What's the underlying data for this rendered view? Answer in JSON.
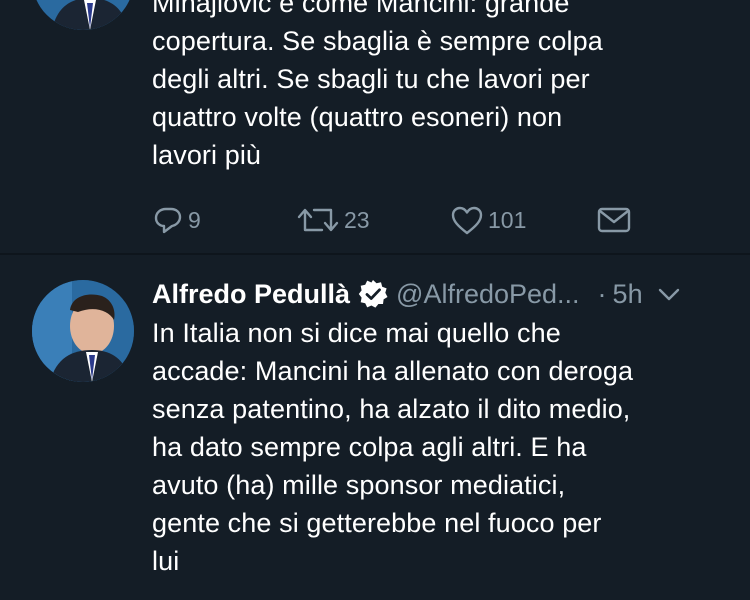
{
  "tweet_top": {
    "text": "Mihajlovic è come Mancini: grande\ncopertura. Se sbaglia è sempre colpa\ndegli altri. Se sbagli tu che lavori per\nquattro volte (quattro esoneri) non\nlavori più",
    "replies": "9",
    "retweets": "23",
    "likes": "101",
    "icons": {
      "reply": "reply-icon",
      "retweet": "retweet-icon",
      "like": "heart-icon",
      "dm": "envelope-icon"
    }
  },
  "tweet_main": {
    "name": "Alfredo Pedullà",
    "handle": "@AlfredoPed...",
    "separator": "·",
    "time": "5h",
    "text": "In Italia non si dice mai quello che\naccade: Mancini ha allenato con deroga\nsenza patentino, ha alzato il dito medio,\nha dato sempre colpa agli altri. E ha\navuto (ha) mille sponsor mediatici,\ngente che si getterebbe nel fuoco per\nlui",
    "icons": {
      "verified": "verified-badge-icon",
      "menu": "chevron-down-icon"
    }
  },
  "colors": {
    "background": "#141d26",
    "text": "#ffffff",
    "secondary": "#8899a6"
  }
}
